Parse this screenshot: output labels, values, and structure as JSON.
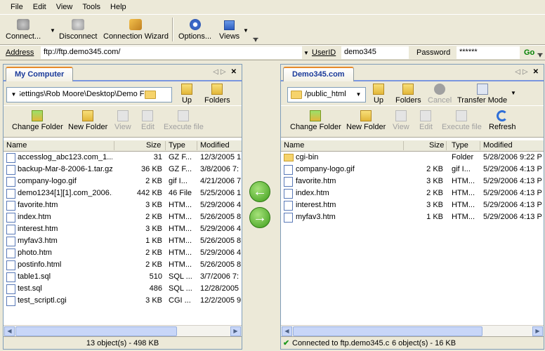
{
  "menu": [
    "File",
    "Edit",
    "View",
    "Tools",
    "Help"
  ],
  "toolbar": {
    "connect": "Connect...",
    "disconnect": "Disconnect",
    "wizard": "Connection Wizard",
    "options": "Options...",
    "views": "Views"
  },
  "address": {
    "label": "Address",
    "value": "ftp://ftp.demo345.com/",
    "userid_label": "UserID",
    "userid": "demo345",
    "password_label": "Password",
    "password": "******",
    "go": "Go"
  },
  "left": {
    "tab": "My Computer",
    "path": "Settings\\Rob Moore\\Desktop\\Demo Files",
    "up": "Up",
    "folders": "Folders",
    "change_folder": "Change Folder",
    "new_folder": "New Folder",
    "view": "View",
    "edit": "Edit",
    "execute": "Execute file",
    "columns": [
      "Name",
      "Size",
      "Type",
      "Modified"
    ],
    "files": [
      [
        "accesslog_abc123.com_1...",
        "31",
        "GZ F...",
        "12/3/2005 1"
      ],
      [
        "backup-Mar-8-2006-1.tar.gz",
        "36 KB",
        "GZ F...",
        "3/8/2006 7:"
      ],
      [
        "company-logo.gif",
        "2 KB",
        "gif I...",
        "4/21/2006 7"
      ],
      [
        "demo1234[1][1].com_2006...",
        "442 KB",
        "46 File",
        "5/25/2006 1"
      ],
      [
        "favorite.htm",
        "3 KB",
        "HTM...",
        "5/29/2006 4"
      ],
      [
        "index.htm",
        "2 KB",
        "HTM...",
        "5/26/2005 8"
      ],
      [
        "interest.htm",
        "3 KB",
        "HTM...",
        "5/29/2006 4"
      ],
      [
        "myfav3.htm",
        "1 KB",
        "HTM...",
        "5/26/2005 8"
      ],
      [
        "photo.htm",
        "2 KB",
        "HTM...",
        "5/29/2006 4"
      ],
      [
        "postinfo.html",
        "2 KB",
        "HTM...",
        "5/26/2005 8"
      ],
      [
        "table1.sql",
        "510",
        "SQL ...",
        "3/7/2006 7:"
      ],
      [
        "test.sql",
        "486",
        "SQL ...",
        "12/28/2005"
      ],
      [
        "test_scriptl.cgi",
        "3 KB",
        "CGI ...",
        "12/2/2005 9"
      ]
    ],
    "status": "13 object(s) - 498 KB"
  },
  "right": {
    "tab": "Demo345.com",
    "path": "/public_html",
    "up": "Up",
    "folders": "Folders",
    "cancel": "Cancel",
    "transfer": "Transfer Mode",
    "change_folder": "Change Folder",
    "new_folder": "New Folder",
    "view": "View",
    "edit": "Edit",
    "execute": "Execute file",
    "refresh": "Refresh",
    "columns": [
      "Name",
      "Size",
      "Type",
      "Modified"
    ],
    "files": [
      [
        "cgi-bin",
        "",
        "Folder",
        "5/28/2006 9:22 P"
      ],
      [
        "company-logo.gif",
        "2 KB",
        "gif I...",
        "5/29/2006 4:13 P"
      ],
      [
        "favorite.htm",
        "3 KB",
        "HTM...",
        "5/29/2006 4:13 P"
      ],
      [
        "index.htm",
        "2 KB",
        "HTM...",
        "5/29/2006 4:13 P"
      ],
      [
        "interest.htm",
        "3 KB",
        "HTM...",
        "5/29/2006 4:13 P"
      ],
      [
        "myfav3.htm",
        "1 KB",
        "HTM...",
        "5/29/2006 4:13 P"
      ]
    ],
    "status_conn": "Connected to ftp.demo345.c",
    "status": "6 object(s) - 16 KB"
  },
  "colors": {
    "accent": "#7a96df",
    "go": "#008000",
    "tab_text": "#1a3a9a"
  }
}
